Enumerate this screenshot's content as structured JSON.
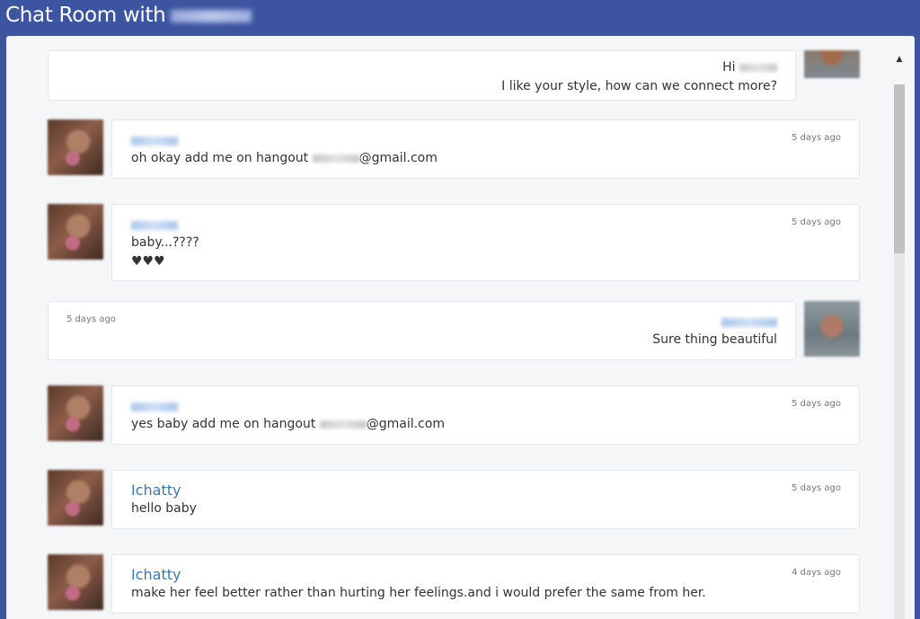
{
  "window": {
    "title": "Chat Room with"
  },
  "messages": [
    {
      "side": "me",
      "sender": "",
      "time": "",
      "lines": [
        "Hi",
        "I like your style, how can we connect more?"
      ]
    },
    {
      "side": "her",
      "sender": "",
      "time": "5 days ago",
      "lines": [
        "oh okay add me on hangout",
        "@gmail.com"
      ]
    },
    {
      "side": "her",
      "sender": "",
      "time": "5 days ago",
      "lines": [
        "baby...????",
        "♥♥♥"
      ]
    },
    {
      "side": "me",
      "sender": "",
      "time": "5 days ago",
      "lines": [
        "Sure thing beautiful"
      ]
    },
    {
      "side": "her",
      "sender": "",
      "time": "5 days ago",
      "lines": [
        "yes baby add me on hangout",
        "@gmail.com"
      ]
    },
    {
      "side": "her",
      "sender": "Ichatty",
      "time": "5 days ago",
      "lines": [
        "hello baby"
      ]
    },
    {
      "side": "her",
      "sender": "Ichatty",
      "time": "4 days ago",
      "lines": [
        "make her feel better rather than hurting her feelings.and i would prefer the same from her."
      ]
    }
  ],
  "icons": {
    "scroll_up": "scroll-up-arrow-icon"
  }
}
